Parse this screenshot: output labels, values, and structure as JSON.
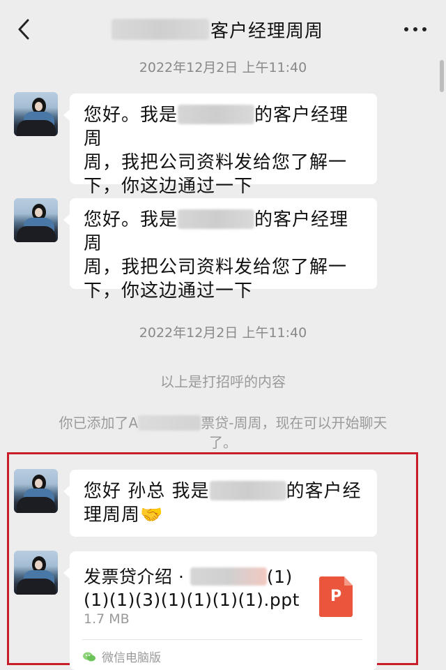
{
  "header": {
    "back_icon": "chevron-left-icon",
    "title": "客户经理周周",
    "more_icon": "more-dots-icon"
  },
  "timestamps": [
    "2022年12月2日 上午11:40",
    "2022年12月2日 上午11:40"
  ],
  "messages": [
    {
      "line1_prefix": "您好。我是",
      "line1_suffix": "的客户经理周",
      "line2": "周，我把公司资料发给您了解一",
      "line3": "下，你这边通过一下"
    },
    {
      "line1_prefix": "您好。我是",
      "line1_suffix": "的客户经理周",
      "line2": "周，我把公司资料发给您了解一",
      "line3": "下，你这边通过一下"
    },
    {
      "line1_prefix": "您好 孙总 我是",
      "line1_suffix": "的客户经",
      "line2": "理周周🤝"
    }
  ],
  "system": {
    "greeting_note": "以上是打招呼的内容",
    "added_prefix": "你已添加了A",
    "added_suffix": "票贷-周周，现在可以开始聊天",
    "added_line2": "了。"
  },
  "file": {
    "name_prefix": "发票贷介绍 ·",
    "name_suffix": "(1)",
    "name_line2": "(1)(1)(3)(1)(1)(1)(1).ppt",
    "size": "1.7 MB",
    "icon_letter": "P",
    "source": "微信电脑版"
  },
  "colors": {
    "background": "#ededed",
    "bubble": "#ffffff",
    "highlight_frame": "#c81e2a",
    "ppt_icon": "#e9563b"
  }
}
